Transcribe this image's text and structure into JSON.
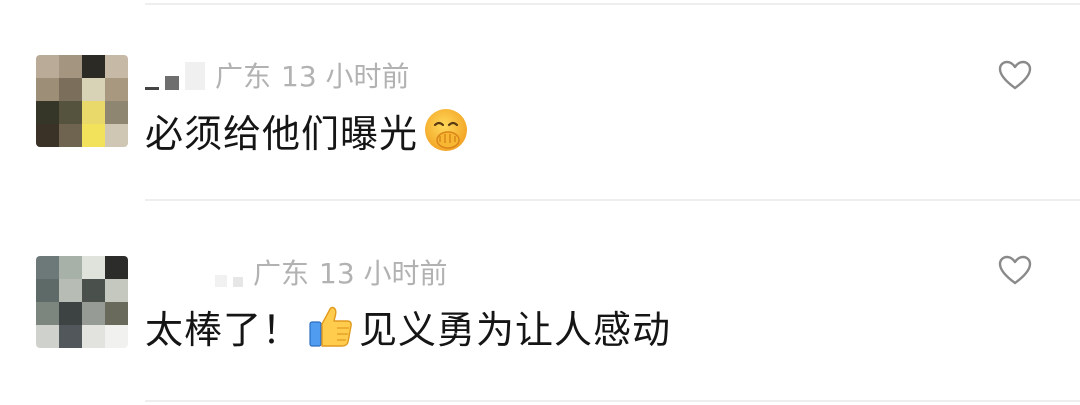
{
  "comments": [
    {
      "location": "广东",
      "time": "13 小时前",
      "text": "必须给他们曝光",
      "emoji_icon": "hand-over-mouth-emoji-icon",
      "like_icon": "heart-outline-icon"
    },
    {
      "location": "广东",
      "time": "13 小时前",
      "text_before": "太棒了！",
      "emoji_icon": "thumbs-up-emoji-icon",
      "text_after": "见义勇为让人感动",
      "like_icon": "heart-outline-icon"
    }
  ],
  "colors": {
    "meta_text": "#b2b2b2",
    "body_text": "#151515",
    "divider": "#eeeeee",
    "like_icon": "#8a8a8a"
  }
}
